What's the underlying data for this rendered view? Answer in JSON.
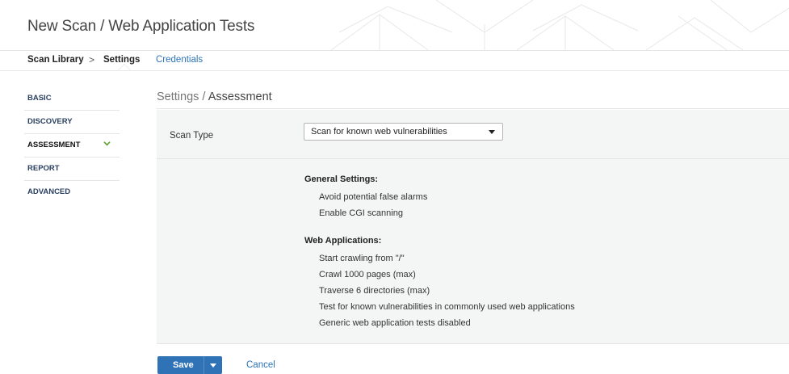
{
  "header": {
    "title": "New Scan / Web Application Tests"
  },
  "subnav": {
    "library": "Scan Library",
    "separator": ">",
    "settings": "Settings",
    "credentials": "Credentials"
  },
  "sidebar": {
    "items": [
      {
        "label": "BASIC"
      },
      {
        "label": "DISCOVERY"
      },
      {
        "label": "ASSESSMENT",
        "active": true,
        "icon": "check-icon"
      },
      {
        "label": "REPORT"
      },
      {
        "label": "ADVANCED"
      }
    ]
  },
  "main": {
    "breadcrumb_parent": "Settings",
    "breadcrumb_sep": " / ",
    "breadcrumb_current": "Assessment",
    "scan_type_label": "Scan Type",
    "scan_type_value": "Scan for known web vulnerabilities",
    "general_header": "General Settings:",
    "general_items": [
      "Avoid potential false alarms",
      "Enable CGI scanning"
    ],
    "webapp_header": "Web Applications:",
    "webapp_items": [
      "Start crawling from \"/\"",
      "Crawl 1000 pages (max)",
      "Traverse 6 directories (max)",
      "Test for known vulnerabilities in commonly used web applications",
      "Generic web application tests disabled"
    ]
  },
  "footer": {
    "save": "Save",
    "cancel": "Cancel"
  },
  "colors": {
    "accent": "#2f72b5",
    "link": "#2c73b8",
    "check": "#5aa02c",
    "panel": "#f4f5f5"
  }
}
